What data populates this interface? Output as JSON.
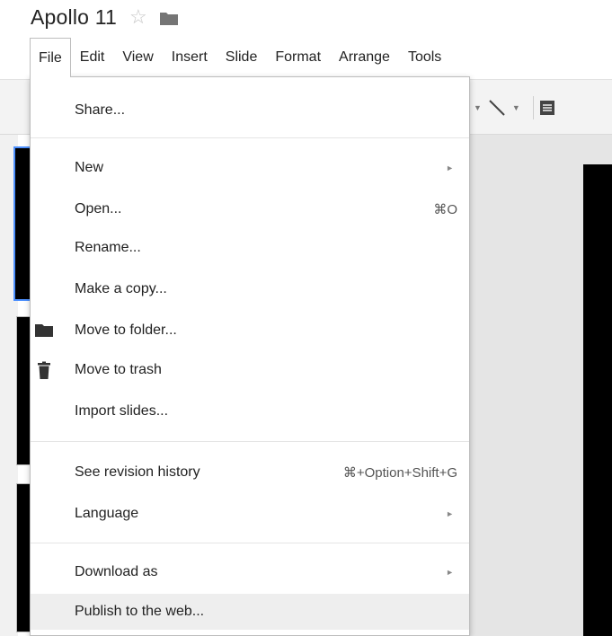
{
  "document": {
    "title": "Apollo 11",
    "star_icon": "star-outline-icon",
    "folder_icon": "folder-icon"
  },
  "menubar": {
    "items": [
      "File",
      "Edit",
      "View",
      "Insert",
      "Slide",
      "Format",
      "Arrange",
      "Tools"
    ],
    "active": "File"
  },
  "toolbar": {
    "icons": [
      "shape-dropdown-icon",
      "line-icon",
      "comment-icon"
    ]
  },
  "file_menu": {
    "share": "Share...",
    "new": "New",
    "open": "Open...",
    "open_shortcut": "⌘O",
    "rename": "Rename...",
    "make_copy": "Make a copy...",
    "move_to_folder": "Move to folder...",
    "move_to_trash": "Move to trash",
    "import_slides": "Import slides...",
    "revision_history": "See revision history",
    "revision_history_shortcut": "⌘+Option+Shift+G",
    "language": "Language",
    "download_as": "Download as",
    "publish": "Publish to the web...",
    "submenu_arrow": "►"
  },
  "colors": {
    "selected_thumb_border": "#4d90fe",
    "menu_hover": "#eeeeee",
    "menu_border": "#bdbdbd"
  }
}
